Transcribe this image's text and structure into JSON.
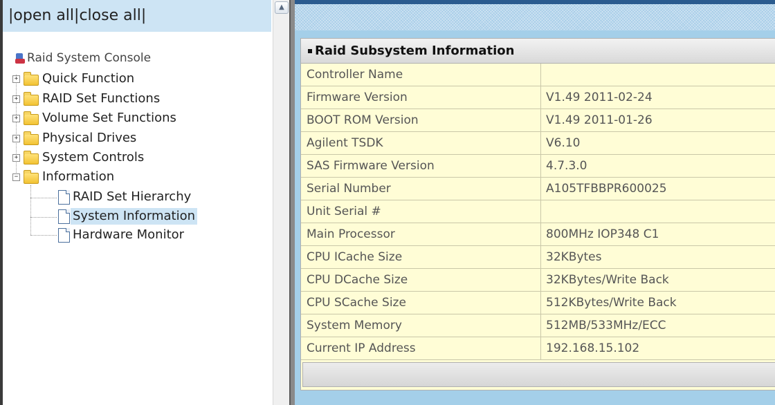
{
  "nav": {
    "open_all": "open all",
    "close_all": "close all",
    "separator": "|"
  },
  "tree": {
    "root_label": "Raid System Console",
    "folders": [
      {
        "label": "Quick Function",
        "state": "collapsed"
      },
      {
        "label": "RAID Set Functions",
        "state": "collapsed"
      },
      {
        "label": "Volume Set Functions",
        "state": "collapsed"
      },
      {
        "label": "Physical Drives",
        "state": "collapsed"
      },
      {
        "label": "System Controls",
        "state": "collapsed"
      },
      {
        "label": "Information",
        "state": "expanded"
      }
    ],
    "information_children": [
      {
        "label": "RAID Set Hierarchy",
        "selected": false
      },
      {
        "label": "System Information",
        "selected": true
      },
      {
        "label": "Hardware Monitor",
        "selected": false
      }
    ]
  },
  "panel": {
    "title": "Raid Subsystem Information",
    "rows": [
      {
        "key": "Controller Name",
        "value": ""
      },
      {
        "key": "Firmware Version",
        "value": "V1.49 2011-02-24"
      },
      {
        "key": "BOOT ROM Version",
        "value": "V1.49 2011-01-26"
      },
      {
        "key": "Agilent TSDK",
        "value": "V6.10"
      },
      {
        "key": "SAS Firmware Version",
        "value": "4.7.3.0"
      },
      {
        "key": "Serial Number",
        "value": "A105TFBBPR600025"
      },
      {
        "key": "Unit Serial #",
        "value": ""
      },
      {
        "key": "Main Processor",
        "value": "800MHz IOP348 C1"
      },
      {
        "key": "CPU ICache Size",
        "value": "32KBytes"
      },
      {
        "key": "CPU DCache Size",
        "value": "32KBytes/Write Back"
      },
      {
        "key": "CPU SCache Size",
        "value": "512KBytes/Write Back"
      },
      {
        "key": "System Memory",
        "value": "512MB/533MHz/ECC"
      },
      {
        "key": "Current IP Address",
        "value": "192.168.15.102"
      }
    ]
  },
  "colors": {
    "nav_bar": "#cde4f4",
    "right_background": "#a4cfe9",
    "table_background": "#fffdd6",
    "header_bar": "#2a5b8f"
  }
}
